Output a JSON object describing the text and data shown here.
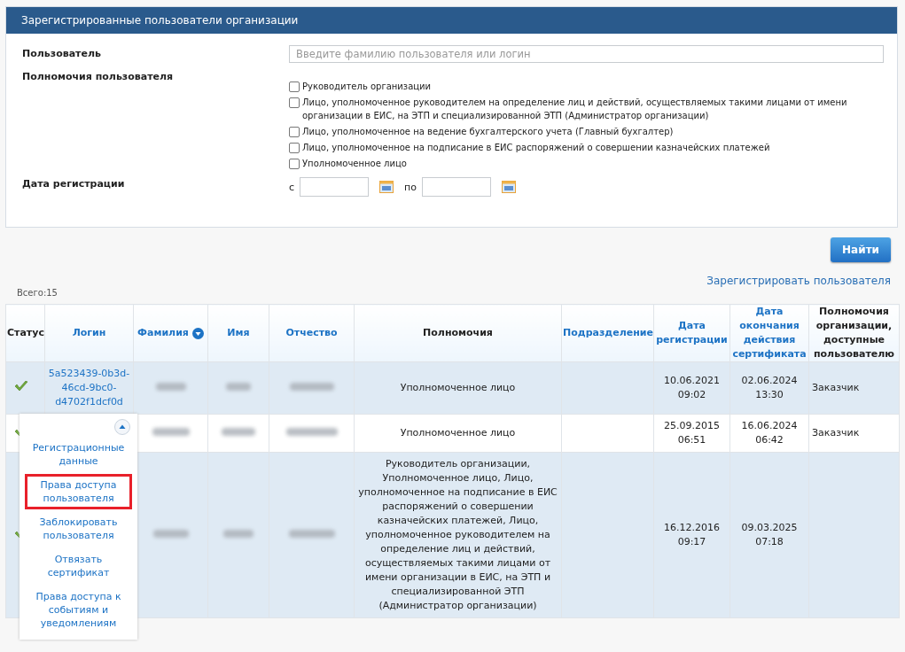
{
  "panel": {
    "title": "Зарегистрированные пользователи организации",
    "user_label": "Пользователь",
    "user_field": {
      "placeholder": "Введите фамилию пользователя или логин"
    },
    "rights_label": "Полномочия пользователя",
    "rights": [
      {
        "label": "Руководитель организации",
        "checked": false
      },
      {
        "label": "Лицо, уполномоченное руководителем на определение лиц и действий, осуществляемых такими лицами от имени организации в ЕИС, на ЭТП и специализированной ЭТП (Администратор организации)",
        "checked": false
      },
      {
        "label": "Лицо, уполномоченное на ведение бухгалтерского учета (Главный бухгалтер)",
        "checked": false
      },
      {
        "label": "Лицо, уполномоченное на подписание в ЕИС распоряжений о совершении казначейских платежей",
        "checked": false
      },
      {
        "label": "Уполномоченное лицо",
        "checked": false
      }
    ],
    "date_label": "Дата регистрации",
    "date_from_label": "с",
    "date_to_label": "по"
  },
  "search_button": "Найти",
  "register_link": "Зарегистрировать пользователя",
  "total": "Всего:15",
  "table": {
    "columns": [
      {
        "label": "Статус",
        "sortable": false,
        "sorted": false
      },
      {
        "label": "Логин",
        "sortable": true,
        "sorted": false
      },
      {
        "label": "Фамилия",
        "sortable": true,
        "sorted": true
      },
      {
        "label": "Имя",
        "sortable": true,
        "sorted": false
      },
      {
        "label": "Отчество",
        "sortable": true,
        "sorted": false
      },
      {
        "label": "Полномочия",
        "sortable": false,
        "sorted": false
      },
      {
        "label": "Подразделение",
        "sortable": true,
        "sorted": false
      },
      {
        "label": "Дата регистрации",
        "sortable": true,
        "sorted": false
      },
      {
        "label": "Дата окончания действия сертификата",
        "sortable": true,
        "sorted": false
      },
      {
        "label": "Полномочия организации, доступные пользователю",
        "sortable": false,
        "sorted": false
      }
    ],
    "rows": [
      {
        "active": true,
        "login": "5a523439-0b3d-46cd-9bc0-d4702f1dcf0d",
        "rights": "Уполномоченное лицо",
        "registered": "10.06.2021 09:02",
        "cert_end": "02.06.2024 13:30",
        "org_rights": "Заказчик"
      },
      {
        "active": true,
        "rights": "Уполномоченное лицо",
        "registered": "25.09.2015 06:51",
        "cert_end": "16.06.2024 06:42",
        "org_rights": "Заказчик"
      },
      {
        "active": true,
        "rights": "Руководитель организации, Уполномоченное лицо, Лицо, уполномоченное на подписание в ЕИС распоряжений о совершении казначейских платежей, Лицо, уполномоченное руководителем на определение лиц и действий, осуществляемых такими лицами от имени организации в ЕИС, на ЭТП и специализированной ЭТП (Администратор организации)",
        "registered": "16.12.2016 09:17",
        "cert_end": "09.03.2025 07:18"
      }
    ]
  },
  "row_menu": {
    "items": [
      {
        "label": "Регистрационные данные",
        "highlighted": false
      },
      {
        "label": "Права доступа пользователя",
        "highlighted": true
      },
      {
        "label": "Заблокировать пользователя",
        "highlighted": false
      },
      {
        "label": "Отвязать сертификат",
        "highlighted": false
      },
      {
        "label": "Права доступа к событиям и уведомлениям",
        "highlighted": false
      }
    ]
  }
}
